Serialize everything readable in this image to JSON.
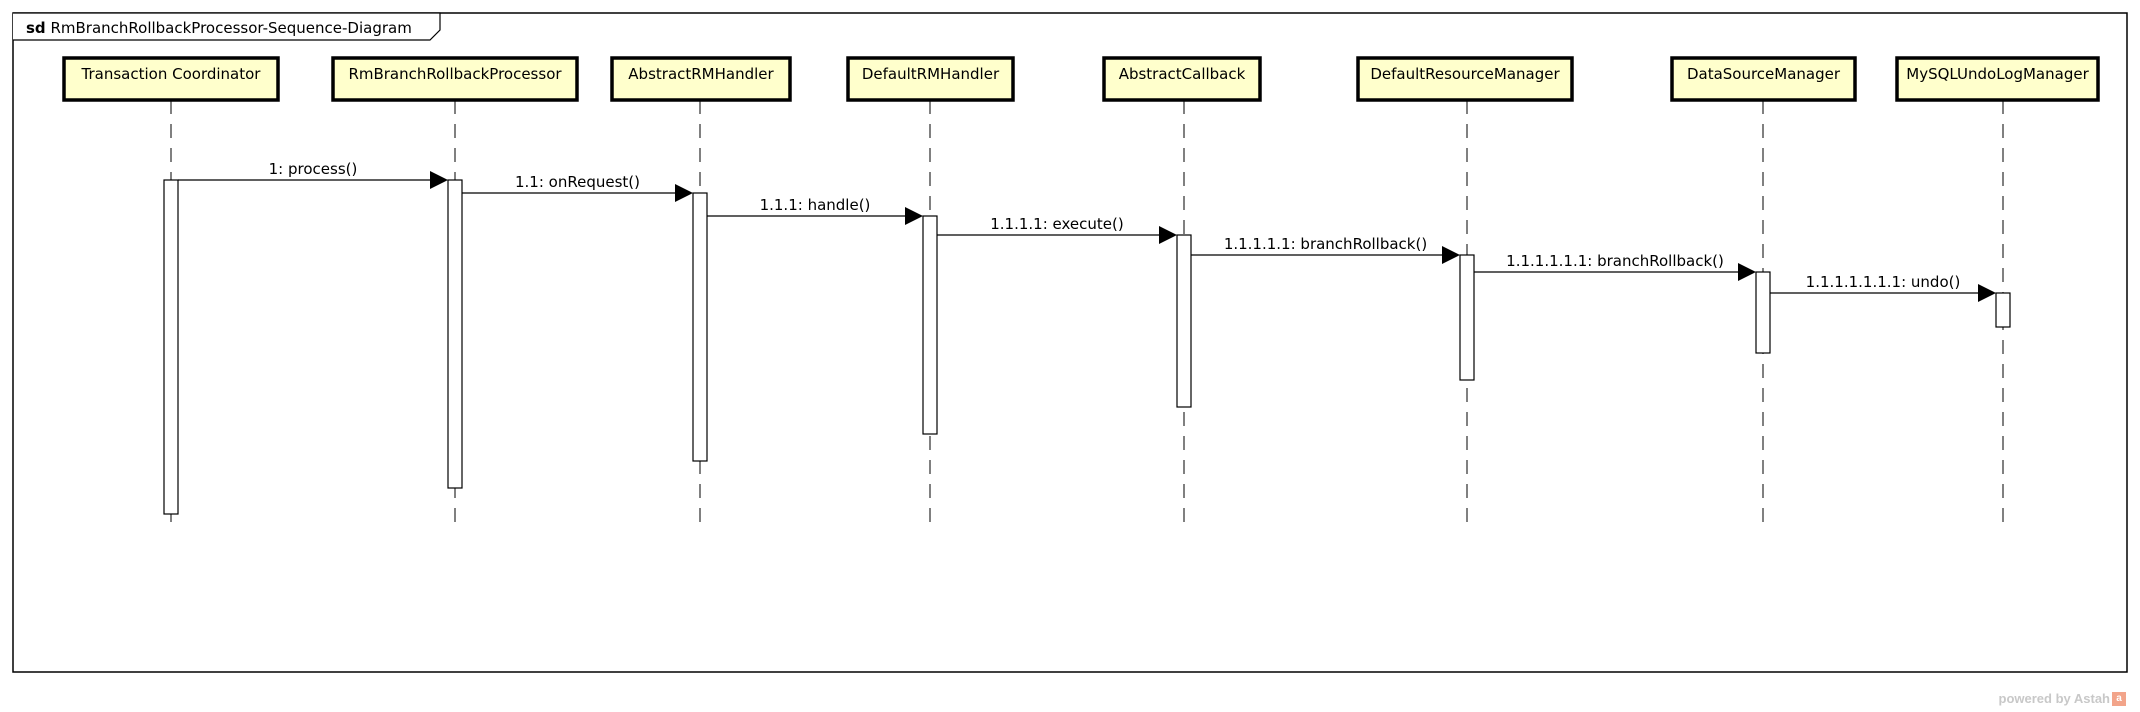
{
  "diagram": {
    "keyword": "sd",
    "name": "RmBranchRollbackProcessor-Sequence-Diagram",
    "lifelines": [
      {
        "id": "tc",
        "label": "Transaction Coordinator"
      },
      {
        "id": "rm",
        "label": "RmBranchRollbackProcessor"
      },
      {
        "id": "arh",
        "label": "AbstractRMHandler"
      },
      {
        "id": "drh",
        "label": "DefaultRMHandler"
      },
      {
        "id": "acb",
        "label": "AbstractCallback"
      },
      {
        "id": "drm",
        "label": "DefaultResourceManager"
      },
      {
        "id": "dsm",
        "label": "DataSourceManager"
      },
      {
        "id": "mul",
        "label": "MySQLUndoLogManager"
      }
    ],
    "messages": [
      {
        "seq": "1",
        "label": "1: process()",
        "from": "tc",
        "to": "rm"
      },
      {
        "seq": "1.1",
        "label": "1.1: onRequest()",
        "from": "rm",
        "to": "arh"
      },
      {
        "seq": "1.1.1",
        "label": "1.1.1: handle()",
        "from": "arh",
        "to": "drh"
      },
      {
        "seq": "1.1.1.1",
        "label": "1.1.1.1: execute()",
        "from": "drh",
        "to": "acb"
      },
      {
        "seq": "1.1.1.1.1",
        "label": "1.1.1.1.1: branchRollback()",
        "from": "acb",
        "to": "drm"
      },
      {
        "seq": "1.1.1.1.1.1",
        "label": "1.1.1.1.1.1: branchRollback()",
        "from": "drm",
        "to": "dsm"
      },
      {
        "seq": "1.1.1.1.1.1.1",
        "label": "1.1.1.1.1.1.1: undo()",
        "from": "dsm",
        "to": "mul"
      }
    ],
    "colors": {
      "lifeline_fill": "#ffffcc",
      "stroke": "#000000"
    }
  },
  "footer": {
    "watermark": "powered by Astah",
    "logo_glyph": "a"
  }
}
